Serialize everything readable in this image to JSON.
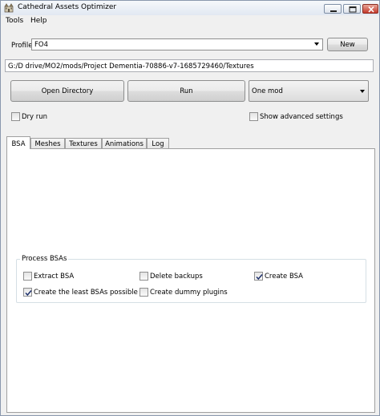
{
  "window": {
    "title": "Cathedral Assets Optimizer",
    "colors": {
      "titlebar": "#e1e8f2",
      "close_button": "#c4392a"
    }
  },
  "menu": {
    "items": [
      "Tools",
      "Help"
    ]
  },
  "profile": {
    "label": "Profile",
    "value": "FO4",
    "new_button": "New"
  },
  "path": {
    "value": "G:/D drive/MO2/mods/Project Dementia-70886-v7-1685729460/Textures"
  },
  "actions": {
    "open_directory": "Open Directory",
    "run": "Run",
    "mode": "One mod"
  },
  "options": {
    "dry_run": {
      "label": "Dry run",
      "checked": false
    },
    "show_advanced": {
      "label": "Show advanced settings",
      "checked": false
    }
  },
  "tabs": [
    "BSA",
    "Meshes",
    "Textures",
    "Animations",
    "Log"
  ],
  "active_tab": "BSA",
  "process_bsas": {
    "title": "Process BSAs",
    "extract_bsa": {
      "label": "Extract BSA",
      "checked": false
    },
    "delete_backups": {
      "label": "Delete backups",
      "checked": false
    },
    "create_bsa": {
      "label": "Create BSA",
      "checked": true
    },
    "create_least": {
      "label": "Create the least BSAs possible",
      "checked": true
    },
    "create_dummy": {
      "label": "Create dummy plugins",
      "checked": false
    }
  }
}
